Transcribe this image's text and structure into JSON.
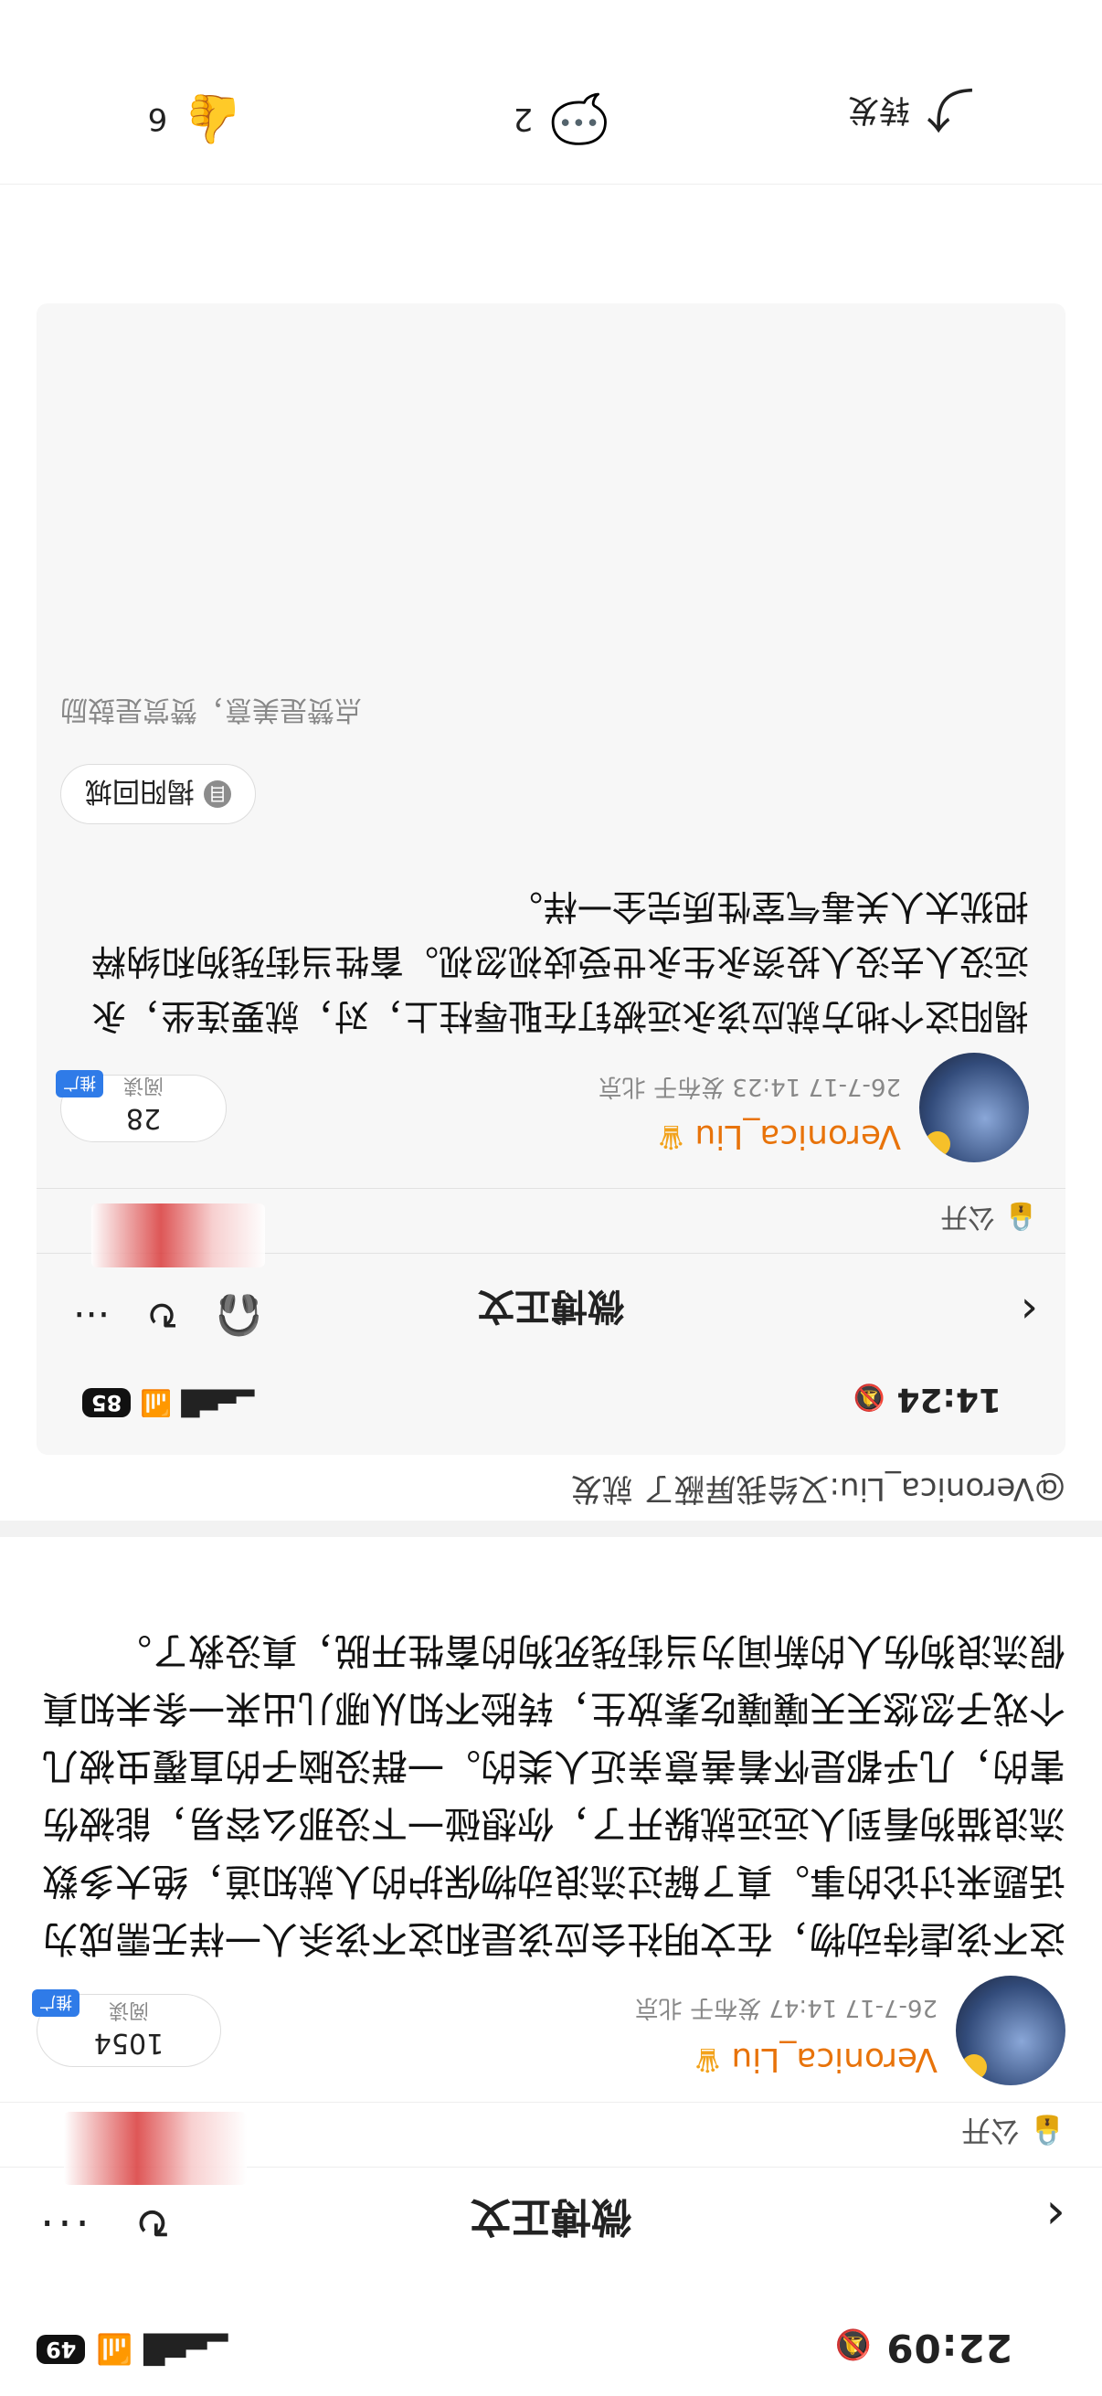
{
  "status_bar": {
    "time": "22:09",
    "battery": "49"
  },
  "nav": {
    "title": "微博正文",
    "back_icon": "chevron-left-icon",
    "refresh_icon": "refresh-icon",
    "more_label": "···"
  },
  "visibility": {
    "label": "公开"
  },
  "post1": {
    "author": "Veronica_Liu",
    "meta": "26-7-17 14:47 发布于 北京",
    "reads": "1054",
    "reads_label": "阅读",
    "promo_label": "推广",
    "text": "这不该虐待动物，在文明社会应该是和这不该杀人一样无需成为话题来讨论的事。真了解过流浪动物保护的人就知道，绝大多数流浪猫狗看到人远远就躲开了，你想碰一下没那么容易，能被伤害的，几乎都是怀着善意亲近人类的。一群没脑子的直覆虫被几个戏子忽悠天天嚷嚷吃素放生，转脸不知从哪儿出来一条未知真假流浪狗伤人的新闻为当街残死狗的畜牲开脱，真没救了。"
  },
  "repost_line": "@Veronica_Liu:又给我屏蔽了 就发",
  "embedded": {
    "status_bar": {
      "time": "14:24",
      "battery": "85"
    },
    "nav": {
      "title": "微博正文",
      "more_label": "···"
    },
    "visibility": {
      "label": "公开"
    },
    "post": {
      "author": "Veronica_Liu",
      "meta": "26-7-17 14:23 发布于 北京",
      "reads": "28",
      "reads_label": "阅读",
      "promo_label": "推广",
      "text": "揭阳这个地方就应该永远被钉在耻辱柱上，对，就要连坐，永远没人去没人投资永生永世受歧视忽视。畜牲当街残狗和纳粹把犹太人关毒气室性质完全一样。",
      "topic": "揭阳回城",
      "footnote": "点赞是美意，赞赏是鼓励"
    }
  },
  "actions": {
    "forward": "转发",
    "comments": "2",
    "likes": "6"
  }
}
